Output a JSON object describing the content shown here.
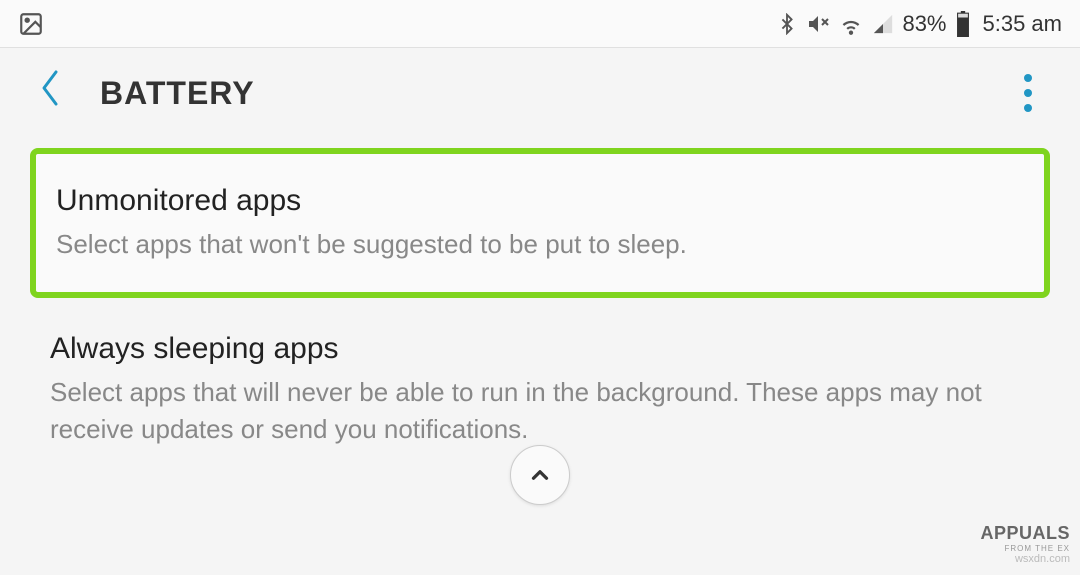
{
  "status_bar": {
    "battery_percent": "83%",
    "time": "5:35 am"
  },
  "header": {
    "title": "BATTERY"
  },
  "settings": {
    "item1": {
      "title": "Unmonitored apps",
      "description": "Select apps that won't be suggested to be put to sleep."
    },
    "item2": {
      "title": "Always sleeping apps",
      "description": "Select apps that will never be able to run in the background. These apps may not receive updates or send you notifications."
    }
  },
  "watermark": {
    "main": "APPUALS",
    "sub": "FROM THE EX",
    "url": "wsxdn.com"
  }
}
